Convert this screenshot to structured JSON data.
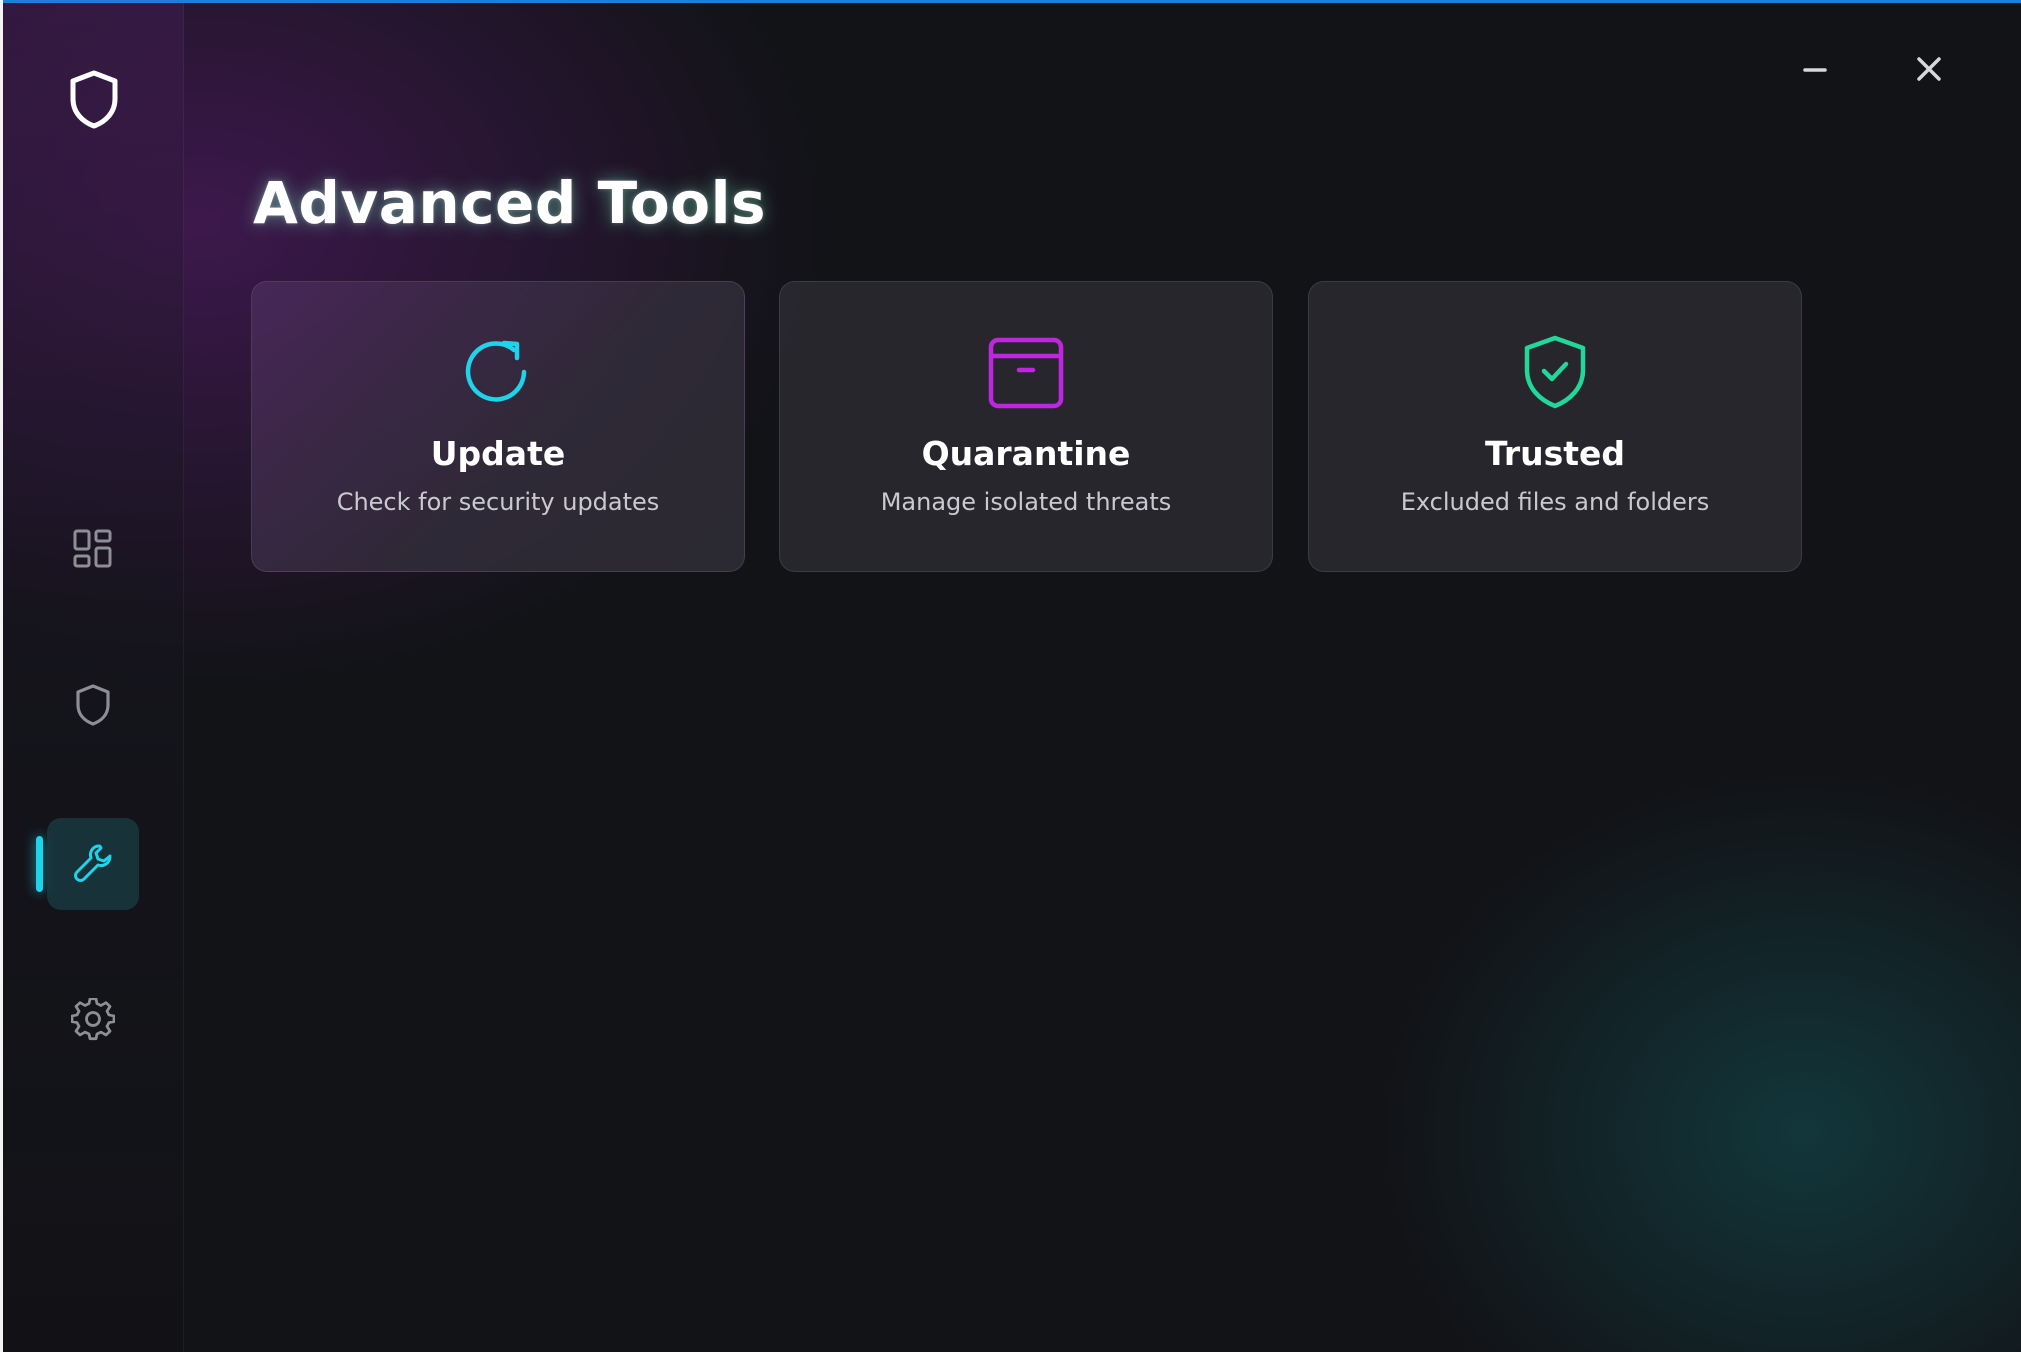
{
  "window": {
    "minimize_icon": "minimize-icon",
    "close_icon": "close-icon",
    "accent_top_border": "#1f7fd6"
  },
  "sidebar": {
    "logo_icon": "shield-icon",
    "items": [
      {
        "name": "dashboard",
        "icon": "grid-icon",
        "active": false
      },
      {
        "name": "protection",
        "icon": "shield-icon",
        "active": false
      },
      {
        "name": "tools",
        "icon": "wrench-icon",
        "active": true
      },
      {
        "name": "settings",
        "icon": "gear-icon",
        "active": false
      }
    ],
    "active_color": "#1fd3ea"
  },
  "main": {
    "title": "Advanced Tools",
    "cards": [
      {
        "title": "Update",
        "subtitle": "Check for security updates",
        "icon": "refresh-icon",
        "color": "#1fd3ea"
      },
      {
        "title": "Quarantine",
        "subtitle": "Manage isolated threats",
        "icon": "archive-box-icon",
        "color": "#c026e0"
      },
      {
        "title": "Trusted",
        "subtitle": "Excluded files and folders",
        "icon": "shield-check-icon",
        "color": "#22d79a"
      }
    ]
  }
}
